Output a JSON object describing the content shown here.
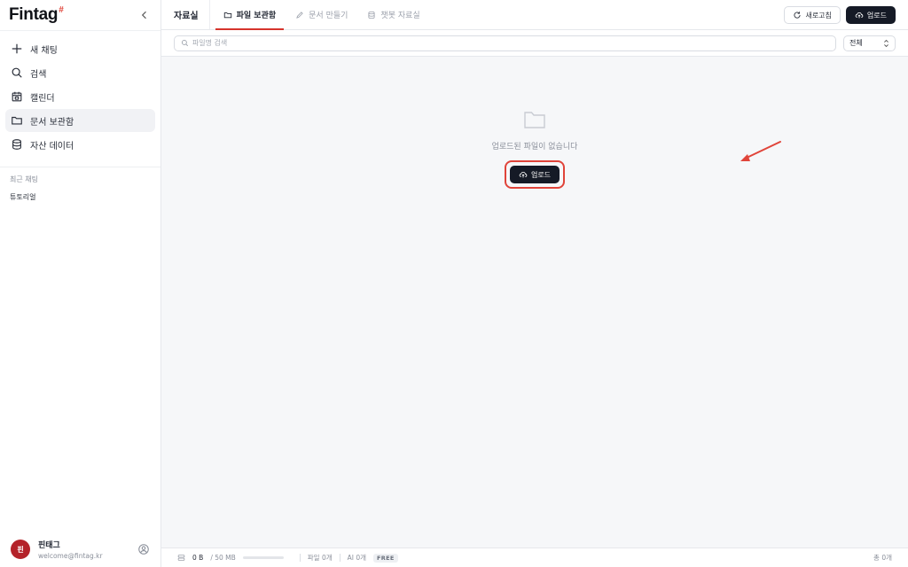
{
  "sidebar": {
    "logo_text": "Fintag",
    "logo_mark": "#",
    "nav": [
      {
        "label": "새 채팅",
        "icon": "plus-icon",
        "active": false
      },
      {
        "label": "검색",
        "icon": "search-icon",
        "active": false
      },
      {
        "label": "캘린더",
        "icon": "calendar-icon",
        "active": false
      },
      {
        "label": "문서 보관함",
        "icon": "folder-icon",
        "active": true
      },
      {
        "label": "자산 데이터",
        "icon": "database-icon",
        "active": false
      }
    ],
    "recent_label": "최근 채팅",
    "recent": [
      "튜토리얼"
    ],
    "profile": {
      "avatar_text": "핀",
      "name": "핀태그",
      "email": "welcome@fintag.kr"
    }
  },
  "header": {
    "title": "자료실",
    "tabs": [
      {
        "label": "파일 보관함",
        "icon": "folder-icon",
        "active": true
      },
      {
        "label": "문서 만들기",
        "icon": "pencil-icon",
        "active": false
      },
      {
        "label": "챗봇 자료실",
        "icon": "database-icon",
        "active": false
      }
    ],
    "refresh_label": "새로고침",
    "upload_label": "업로드"
  },
  "filter": {
    "search_placeholder": "파일명 검색",
    "select_value": "전체"
  },
  "empty_state": {
    "message": "업로드된 파일이 없습니다",
    "upload_label": "업로드"
  },
  "status": {
    "used": "0 B",
    "quota": "/ 50 MB",
    "usage_fraction": 0,
    "files": "파일 0개",
    "ai": "AI 0개",
    "plan": "FREE",
    "total": "총 0개"
  },
  "colors": {
    "accent": "#d6342c",
    "dark": "#151a26",
    "avatar": "#b4232a"
  }
}
